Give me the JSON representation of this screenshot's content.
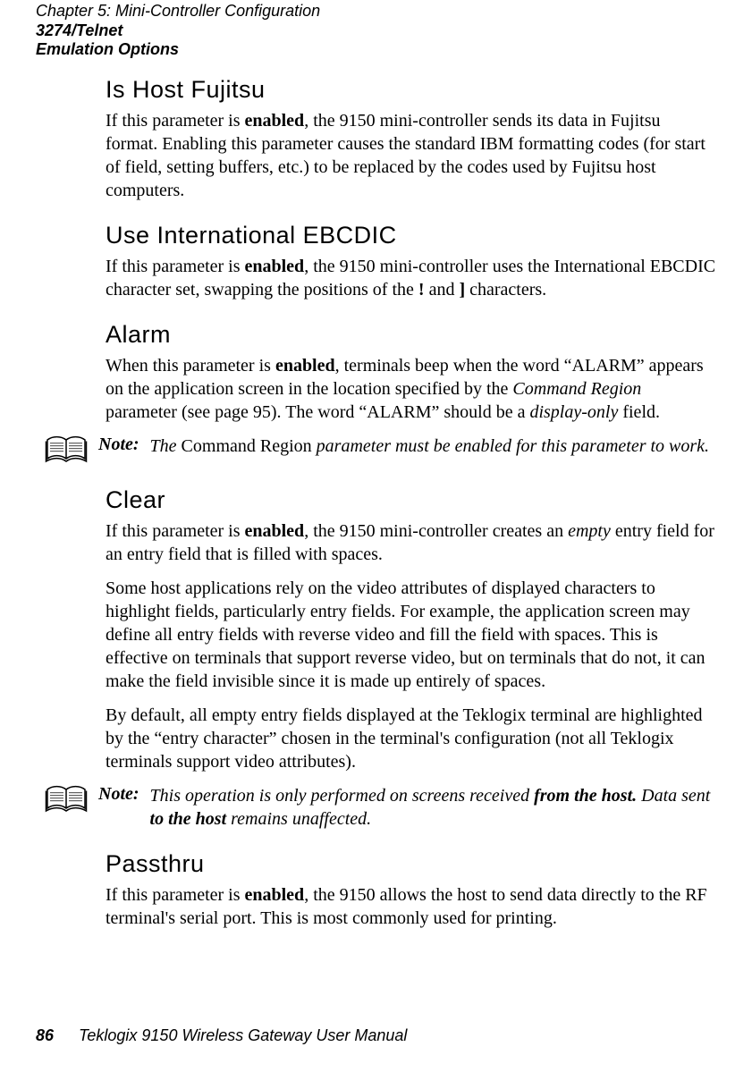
{
  "running_header": {
    "chapter": "Chapter 5:  Mini-Controller Configuration",
    "section": "3274/Telnet",
    "subsection": "Emulation Options"
  },
  "sections": {
    "is_host_fujitsu": {
      "heading": "Is Host Fujitsu",
      "para_pre": "If this parameter is ",
      "para_bold": "enabled",
      "para_post": ", the 9150 mini-controller sends its data in Fujitsu format. Enabling this parameter causes the standard IBM formatting codes (for start of field, setting buffers, etc.) to be replaced by the codes used by Fujitsu host computers."
    },
    "use_international_ebcdic": {
      "heading": "Use International EBCDIC",
      "para_pre": "If this parameter is ",
      "para_bold": "enabled",
      "para_mid": ", the 9150 mini-controller uses the International EBCDIC character set, swapping the positions of the ",
      "char1": "!",
      "and": " and ",
      "char2": "]",
      "post": " characters."
    },
    "alarm": {
      "heading": "Alarm",
      "para_pre": "When this parameter is ",
      "para_bold": "enabled",
      "para_mid1": ", terminals beep when the word “ALARM” appears on the application screen in the location specified by the ",
      "cmd_region": "Command Region",
      "para_mid2": " parameter (see page 95). The word “ALARM” should be a ",
      "display_only": "display-only",
      "para_post": " field.",
      "note_label": "Note:",
      "note_pre": "The ",
      "note_roman": "Command Region",
      "note_post": " parameter must be enabled for this parameter to work."
    },
    "clear": {
      "heading": "Clear",
      "p1_pre": "If this parameter is ",
      "p1_bold": "enabled",
      "p1_mid": ", the 9150 mini-controller creates an ",
      "p1_empty": "empty",
      "p1_post": " entry field for an entry field that is filled with spaces.",
      "p2": "Some host applications rely on the video attributes of displayed characters to highlight fields, particularly entry fields. For example, the application screen may define all entry fields with reverse video and fill the field with spaces. This is effective on terminals that support reverse video, but on terminals that do not, it can make the field invisible since it is made up entirely of spaces.",
      "p3": "By default, all empty entry fields displayed at the Teklogix terminal are highlighted by the “entry character” chosen in the terminal's configuration (not all Teklogix terminals support video attributes).",
      "note_label": "Note:",
      "note_pre": "This operation is only performed on screens received ",
      "note_b1": "from the host.",
      "note_mid": " Data sent ",
      "note_b2": "to the host",
      "note_post": " remains unaffected."
    },
    "passthru": {
      "heading": "Passthru",
      "para_pre": "If this parameter is ",
      "para_bold": "enabled",
      "para_post": ", the 9150 allows the host to send data directly to the RF terminal's serial port. This is most commonly used for printing."
    }
  },
  "footer": {
    "page_number": "86",
    "doc_title": "Teklogix 9150 Wireless Gateway User Manual"
  }
}
